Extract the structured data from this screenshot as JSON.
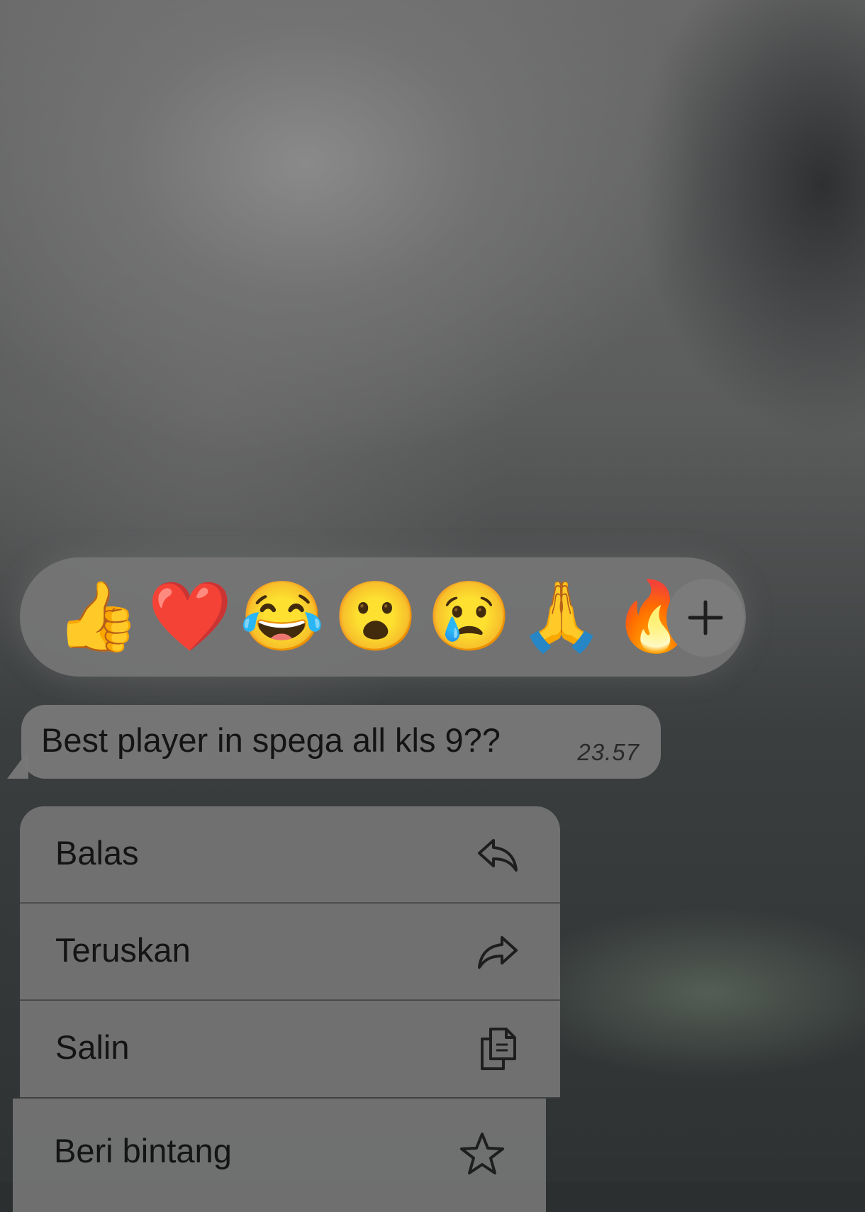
{
  "reactions": {
    "emojis": [
      {
        "name": "thumbs-up",
        "char": "👍"
      },
      {
        "name": "red-heart",
        "char": "❤️"
      },
      {
        "name": "tears-of-joy",
        "char": "😂"
      },
      {
        "name": "surprised",
        "char": "😮"
      },
      {
        "name": "crying",
        "char": "😢"
      },
      {
        "name": "folded-hands",
        "char": "🙏"
      },
      {
        "name": "fire",
        "char": "🔥"
      }
    ],
    "add_icon": "plus-icon"
  },
  "message": {
    "text": "Best player in spega all kls 9??",
    "time": "23.57"
  },
  "menu": {
    "items": [
      {
        "label": "Balas",
        "icon": "reply-icon"
      },
      {
        "label": "Teruskan",
        "icon": "forward-icon"
      },
      {
        "label": "Salin",
        "icon": "copy-icon"
      },
      {
        "label": "Beri bintang",
        "icon": "star-icon"
      }
    ]
  }
}
